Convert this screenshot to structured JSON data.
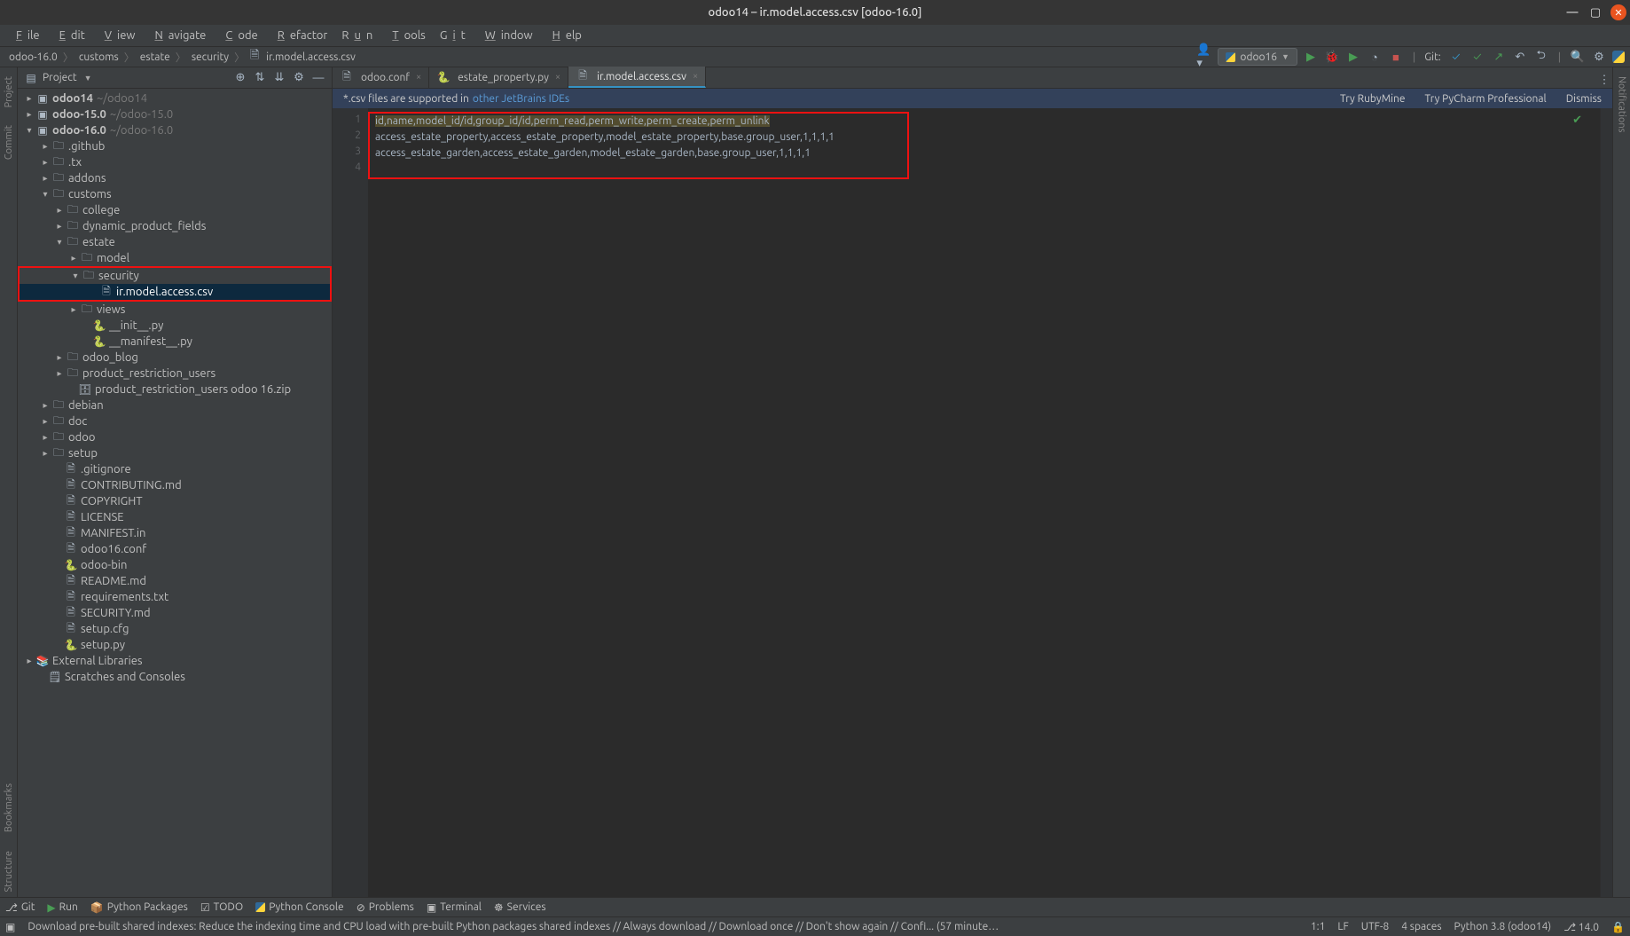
{
  "titlebar": {
    "title": "odoo14 – ir.model.access.csv [odoo-16.0]"
  },
  "menu": {
    "file": "File",
    "edit": "Edit",
    "view": "View",
    "navigate": "Navigate",
    "code": "Code",
    "refactor": "Refactor",
    "run": "Run",
    "tools": "Tools",
    "git": "Git",
    "window": "Window",
    "help": "Help"
  },
  "breadcrumbs": [
    "odoo-16.0",
    "customs",
    "estate",
    "security",
    "ir.model.access.csv"
  ],
  "run_config": {
    "label": "odoo16"
  },
  "git_label": "Git:",
  "project_header": "Project",
  "tree": {
    "n1": "odoo14",
    "n1p": "~/odoo14",
    "n2": "odoo-15.0",
    "n2p": "~/odoo-15.0",
    "n3": "odoo-16.0",
    "n3p": "~/odoo-16.0",
    "github": ".github",
    "tx": ".tx",
    "addons": "addons",
    "customs": "customs",
    "college": "college",
    "dpf": "dynamic_product_fields",
    "estate": "estate",
    "model": "model",
    "security": "security",
    "iraccess": "ir.model.access.csv",
    "views": "views",
    "init": "__init__.py",
    "manifest": "__manifest__.py",
    "odoo_blog": "odoo_blog",
    "pru": "product_restriction_users",
    "pruz": "product_restriction_users odoo 16.zip",
    "debian": "debian",
    "doc": "doc",
    "odoo": "odoo",
    "setup": "setup",
    "gitignore": ".gitignore",
    "contributing": "CONTRIBUTING.md",
    "copyright": "COPYRIGHT",
    "license": "LICENSE",
    "manifestin": "MANIFEST.in",
    "odoo16conf": "odoo16.conf",
    "odoobin": "odoo-bin",
    "readme": "README.md",
    "req": "requirements.txt",
    "securitymd": "SECURITY.md",
    "setupcfg": "setup.cfg",
    "setuppy": "setup.py",
    "extlib": "External Libraries",
    "scratch": "Scratches and Consoles"
  },
  "tabs": {
    "t1": "odoo.conf",
    "t2": "estate_property.py",
    "t3": "ir.model.access.csv"
  },
  "banner": {
    "text": "*.csv files are supported in ",
    "link": "other JetBrains IDEs",
    "try_ruby": "Try RubyMine",
    "try_pycharm": "Try PyCharm Professional",
    "dismiss": "Dismiss"
  },
  "code": {
    "l1": "id,name,model_id/id,group_id/id,perm_read,perm_write,perm_create,perm_unlink",
    "l2": "access_estate_property,access_estate_property,model_estate_property,base.group_user,1,1,1,1",
    "l3": "access_estate_garden,access_estate_garden,model_estate_garden,base.group_user,1,1,1,1"
  },
  "gutters": {
    "g1": "1",
    "g2": "2",
    "g3": "3",
    "g4": "4"
  },
  "leftbar": {
    "project": "Project",
    "commit": "Commit",
    "bookmarks": "Bookmarks",
    "structure": "Structure"
  },
  "rightbar": {
    "notifications": "Notifications"
  },
  "bottom": {
    "git": "Git",
    "run": "Run",
    "pypkg": "Python Packages",
    "todo": "TODO",
    "pyconsole": "Python Console",
    "problems": "Problems",
    "terminal": "Terminal",
    "services": "Services"
  },
  "status": {
    "msg": "Download pre-built shared indexes: Reduce the indexing time and CPU load with pre-built Python packages shared indexes // Always download // Download once // Don't show again // Confi... (57 minutes ago)",
    "pos": "1:1",
    "lf": "LF",
    "enc": "UTF-8",
    "indent": "4 spaces",
    "py": "Python 3.8 (odoo14)",
    "branch": "14.0"
  }
}
